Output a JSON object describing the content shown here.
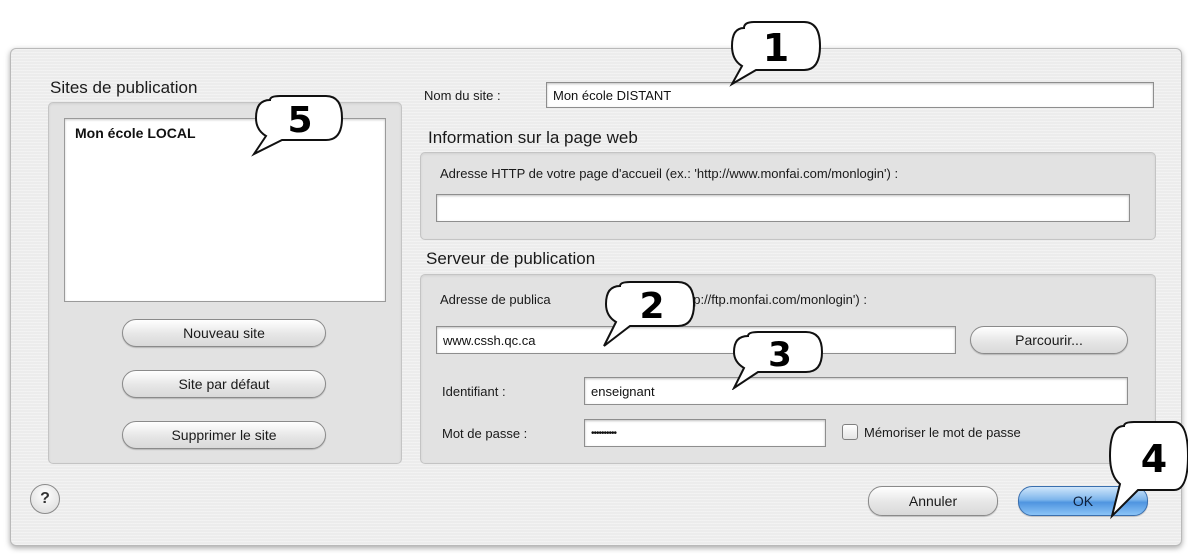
{
  "sidebar": {
    "title": "Sites de publication",
    "sites": [
      "Mon école LOCAL"
    ],
    "buttons": {
      "new": "Nouveau site",
      "default": "Site par défaut",
      "delete": "Supprimer le site"
    }
  },
  "site": {
    "name_label": "Nom du site :",
    "name_value": "Mon école DISTANT"
  },
  "webpage_info": {
    "title": "Information sur la page web",
    "http_label": "Adresse HTTP de votre page d'accueil (ex.: 'http://www.monfai.com/monlogin') :",
    "http_value": ""
  },
  "publish_server": {
    "title": "Serveur de publication",
    "address_label_start": "Adresse de publica",
    "address_label_end": "ftp://ftp.monfai.com/monlogin') :",
    "address_value": "www.cssh.qc.ca",
    "browse_label": "Parcourir...",
    "user_label": "Identifiant :",
    "user_value": "enseignant",
    "password_label": "Mot de passe :",
    "password_value": "••••••••••",
    "remember_label": "Mémoriser le mot de passe",
    "remember_checked": false
  },
  "footer": {
    "help_symbol": "?",
    "cancel_label": "Annuler",
    "ok_label": "OK"
  },
  "callouts": [
    "1",
    "2",
    "3",
    "4",
    "5"
  ],
  "colors": {
    "dialog_bg": "#ececec",
    "ok_button": "#5a9ee6"
  }
}
